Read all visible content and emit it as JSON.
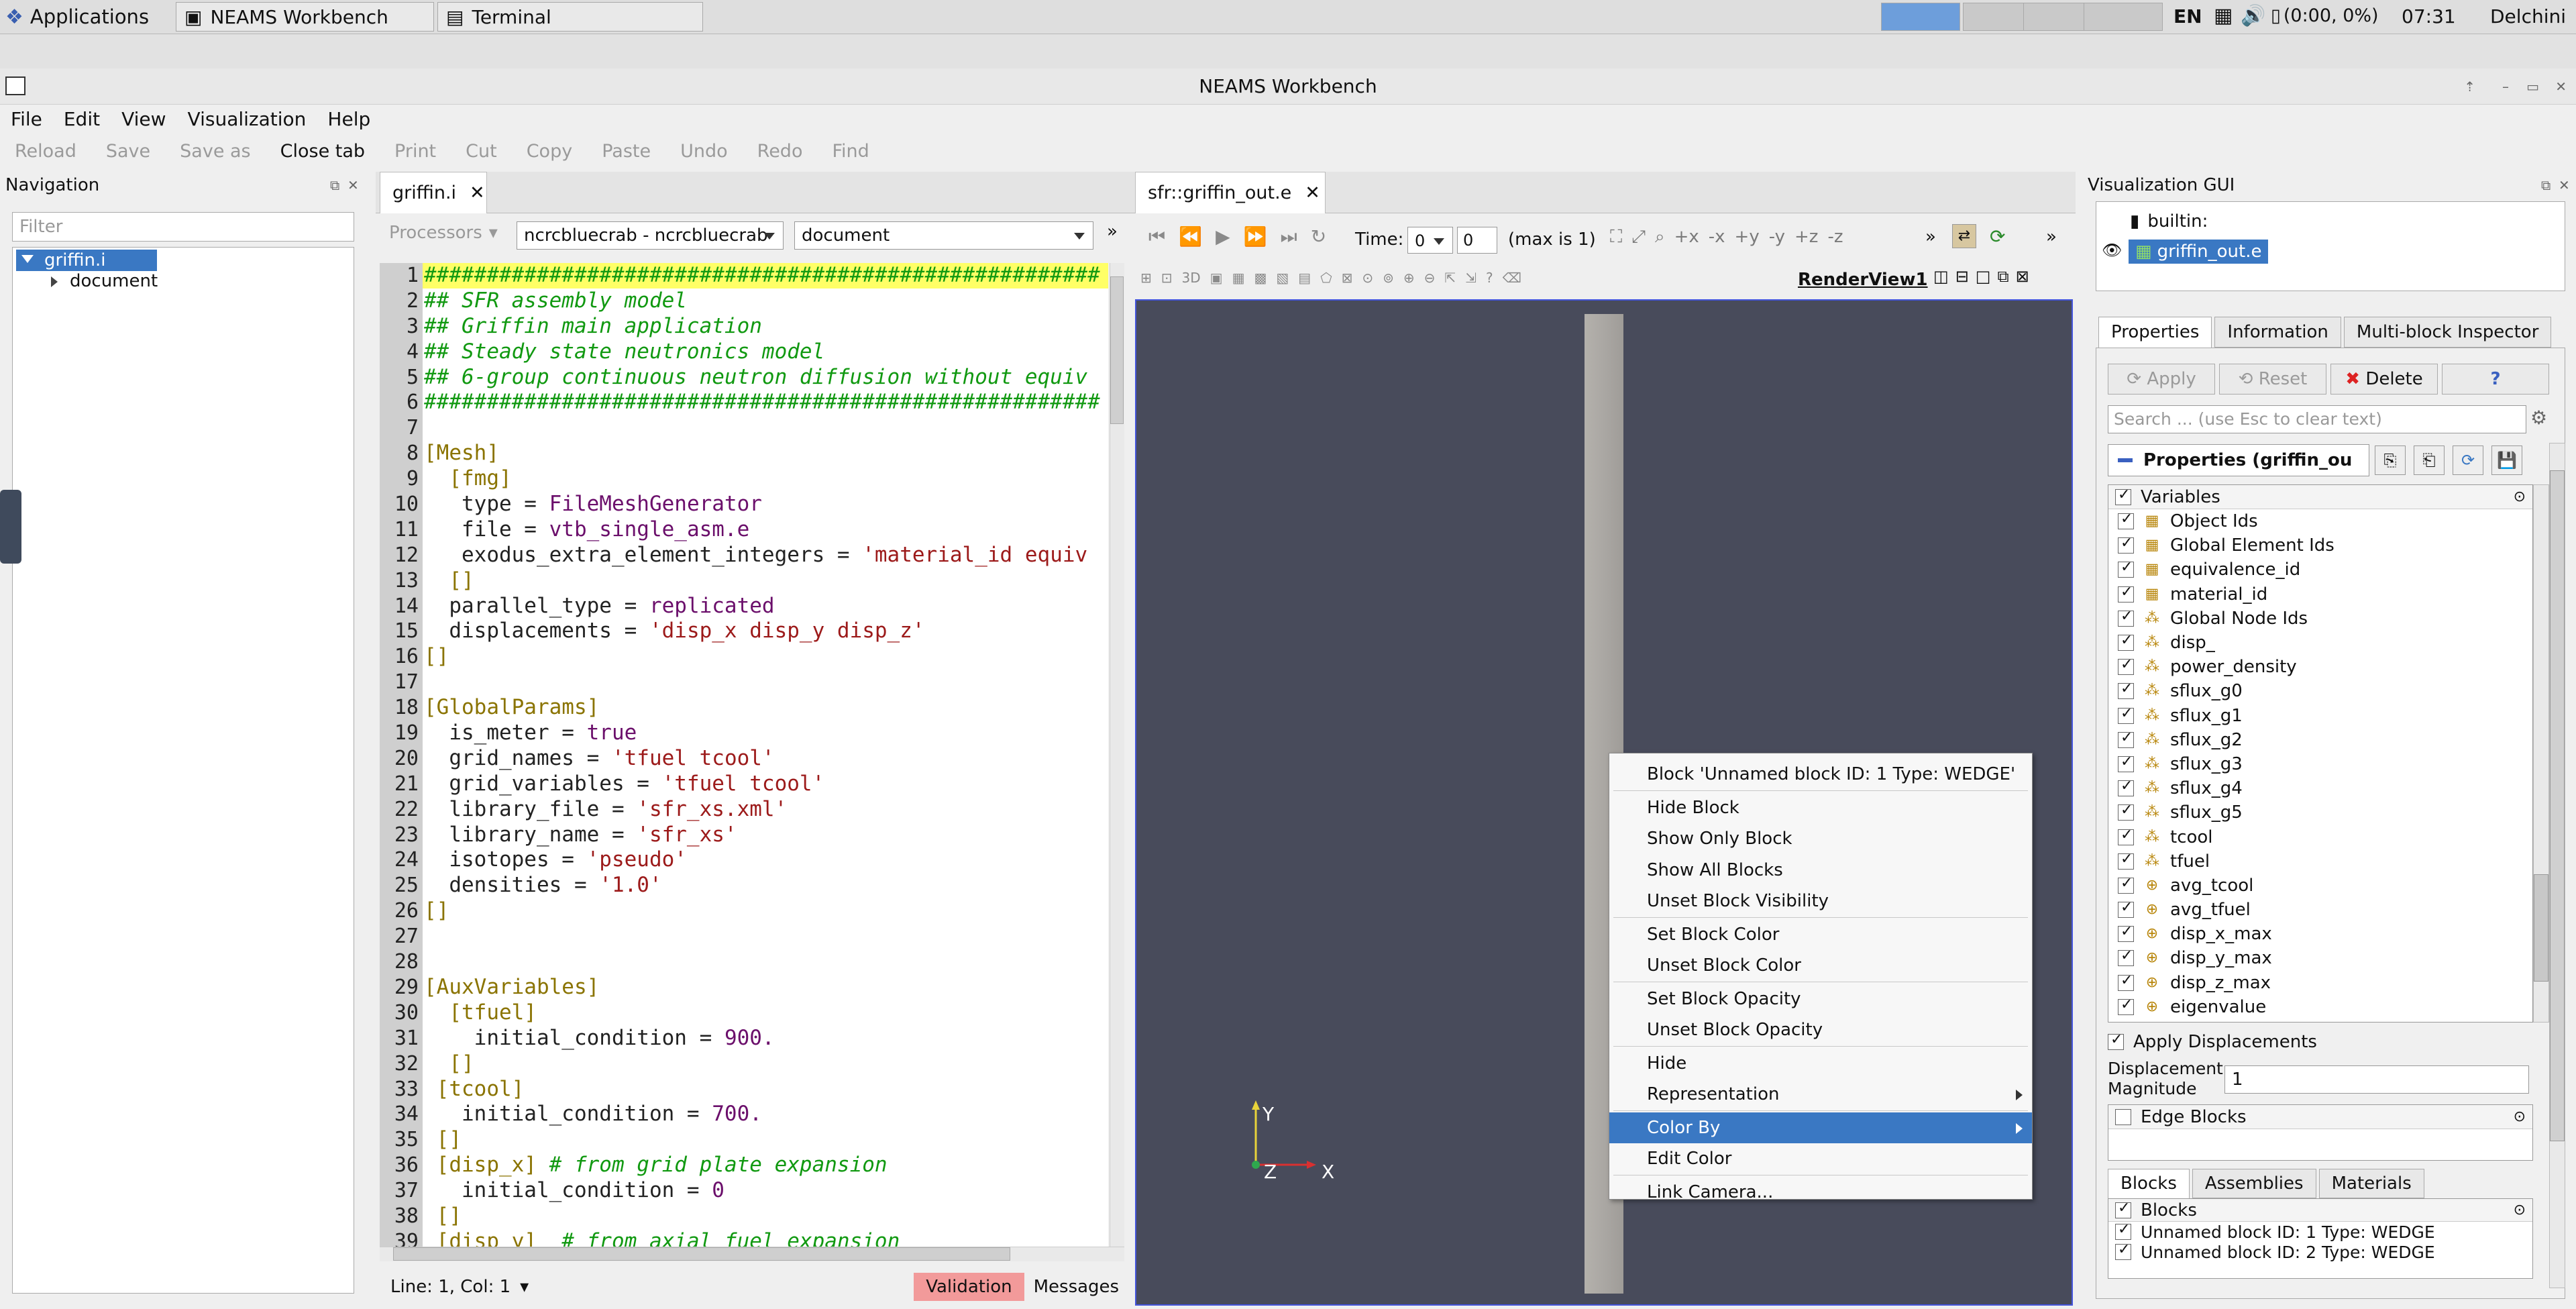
{
  "taskbar": {
    "applications": "Applications",
    "tasks": [
      "NEAMS Workbench",
      "Terminal"
    ],
    "lang": "EN",
    "battery": "(0:00, 0%)",
    "clock": "07:31",
    "user": "Delchini"
  },
  "window": {
    "title": "NEAMS Workbench"
  },
  "menu": [
    "File",
    "Edit",
    "View",
    "Visualization",
    "Help"
  ],
  "toolbar": [
    "Reload",
    "Save",
    "Save as",
    "Close tab",
    "Print",
    "Cut",
    "Copy",
    "Paste",
    "Undo",
    "Redo",
    "Find"
  ],
  "navigation": {
    "title": "Navigation",
    "filter_placeholder": "Filter",
    "root": "griffin.i",
    "child": "document"
  },
  "editor": {
    "tab": "griffin.i",
    "processors_label": "Processors",
    "processor": "ncrcbluecrab - ncrcbluecrab",
    "mode": "document",
    "status": "Line: 1, Col: 1",
    "validation": "Validation",
    "messages": "Messages",
    "lines": [
      {
        "n": "1",
        "t": "cm",
        "s": "######################################################"
      },
      {
        "n": "2",
        "t": "cm",
        "s": "## SFR assembly model"
      },
      {
        "n": "3",
        "t": "cm",
        "s": "## Griffin main application"
      },
      {
        "n": "4",
        "t": "cm",
        "s": "## Steady state neutronics model"
      },
      {
        "n": "5",
        "t": "cm",
        "s": "## 6-group continuous neutron diffusion without equiv"
      },
      {
        "n": "6",
        "t": "cm",
        "s": "######################################################"
      },
      {
        "n": "7",
        "t": "key",
        "s": ""
      },
      {
        "n": "8",
        "t": "sec",
        "s": "[Mesh]"
      },
      {
        "n": "9",
        "t": "sec",
        "s": "  [fmg]"
      },
      {
        "n": "10",
        "t": "kv",
        "k": "   type = ",
        "v": "FileMeshGenerator",
        "vt": "kw"
      },
      {
        "n": "11",
        "t": "kv",
        "k": "   file = ",
        "v": "vtb_single_asm.e",
        "vt": "kw"
      },
      {
        "n": "12",
        "t": "kv",
        "k": "   exodus_extra_element_integers = ",
        "v": "'material_id equiv",
        "vt": "str"
      },
      {
        "n": "13",
        "t": "sec",
        "s": "  []"
      },
      {
        "n": "14",
        "t": "kv",
        "k": "  parallel_type = ",
        "v": "replicated",
        "vt": "kw"
      },
      {
        "n": "15",
        "t": "kv",
        "k": "  displacements = ",
        "v": "'disp_x disp_y disp_z'",
        "vt": "str"
      },
      {
        "n": "16",
        "t": "sec",
        "s": "[]"
      },
      {
        "n": "17",
        "t": "key",
        "s": ""
      },
      {
        "n": "18",
        "t": "sec",
        "s": "[GlobalParams]"
      },
      {
        "n": "19",
        "t": "kv",
        "k": "  is_meter = ",
        "v": "true",
        "vt": "kw"
      },
      {
        "n": "20",
        "t": "kv",
        "k": "  grid_names = ",
        "v": "'tfuel tcool'",
        "vt": "str"
      },
      {
        "n": "21",
        "t": "kv",
        "k": "  grid_variables = ",
        "v": "'tfuel tcool'",
        "vt": "str"
      },
      {
        "n": "22",
        "t": "kv",
        "k": "  library_file = ",
        "v": "'sfr_xs.xml'",
        "vt": "str"
      },
      {
        "n": "23",
        "t": "kv",
        "k": "  library_name = ",
        "v": "'sfr_xs'",
        "vt": "str"
      },
      {
        "n": "24",
        "t": "kv",
        "k": "  isotopes = ",
        "v": "'pseudo'",
        "vt": "str"
      },
      {
        "n": "25",
        "t": "kv",
        "k": "  densities = ",
        "v": "'1.0'",
        "vt": "str"
      },
      {
        "n": "26",
        "t": "sec",
        "s": "[]"
      },
      {
        "n": "27",
        "t": "key",
        "s": ""
      },
      {
        "n": "28",
        "t": "key",
        "s": ""
      },
      {
        "n": "29",
        "t": "sec",
        "s": "[AuxVariables]"
      },
      {
        "n": "30",
        "t": "sec",
        "s": "  [tfuel]"
      },
      {
        "n": "31",
        "t": "kv",
        "k": "    initial_condition = ",
        "v": "900.",
        "vt": "kw"
      },
      {
        "n": "32",
        "t": "sec",
        "s": "  []"
      },
      {
        "n": "33",
        "t": "sec",
        "s": " [tcool]"
      },
      {
        "n": "34",
        "t": "kv",
        "k": "   initial_condition = ",
        "v": "700.",
        "vt": "kw"
      },
      {
        "n": "35",
        "t": "sec",
        "s": " []"
      },
      {
        "n": "36",
        "t": "seccm",
        "k": " [disp_x]",
        "v": " # from grid plate expansion"
      },
      {
        "n": "37",
        "t": "kv",
        "k": "   initial_condition = ",
        "v": "0",
        "vt": "kw"
      },
      {
        "n": "38",
        "t": "sec",
        "s": " []"
      },
      {
        "n": "39",
        "t": "seccm",
        "k": " [disp_y]",
        "v": "  # from axial fuel expansion"
      }
    ]
  },
  "viewer": {
    "tab": "sfr::griffin_out.e",
    "time_label": "Time:",
    "time_value": "0",
    "time_index": "0",
    "time_max": "(max is 1)",
    "render_view": "RenderView1",
    "axis_y": "Y",
    "axis_z": "Z",
    "axis_x": "X"
  },
  "context_menu": {
    "items": [
      {
        "label": "Block 'Unnamed block ID: 1 Type: WEDGE'"
      },
      {
        "sep": true
      },
      {
        "label": "Hide Block"
      },
      {
        "label": "Show Only Block"
      },
      {
        "label": "Show All Blocks"
      },
      {
        "label": "Unset Block Visibility"
      },
      {
        "sep": true
      },
      {
        "label": "Set Block Color"
      },
      {
        "label": "Unset Block Color"
      },
      {
        "sep": true
      },
      {
        "label": "Set Block Opacity"
      },
      {
        "label": "Unset Block Opacity"
      },
      {
        "sep": true
      },
      {
        "label": "Hide"
      },
      {
        "label": "Representation",
        "sub": true
      },
      {
        "sep": true
      },
      {
        "label": "Color By",
        "sub": true,
        "selected": true
      },
      {
        "label": "Edit Color"
      },
      {
        "sep": true
      },
      {
        "label": "Link Camera..."
      }
    ]
  },
  "vis_gui": {
    "title": "Visualization GUI",
    "pipeline": [
      "builtin:",
      "griffin_out.e"
    ],
    "tabs": [
      "Properties",
      "Information",
      "Multi-block Inspector"
    ],
    "apply": "Apply",
    "reset": "Reset",
    "delete": "Delete",
    "help": "?",
    "search_placeholder": "Search ... (use Esc to clear text)",
    "properties_header": "Properties (griffin_ou",
    "variables_header": "Variables",
    "variables": [
      {
        "name": "Object Ids",
        "icon": "cell"
      },
      {
        "name": "Global Element Ids",
        "icon": "cell"
      },
      {
        "name": "equivalence_id",
        "icon": "cell"
      },
      {
        "name": "material_id",
        "icon": "cell"
      },
      {
        "name": "Global Node Ids",
        "icon": "point"
      },
      {
        "name": "disp_",
        "icon": "point"
      },
      {
        "name": "power_density",
        "icon": "point"
      },
      {
        "name": "sflux_g0",
        "icon": "point"
      },
      {
        "name": "sflux_g1",
        "icon": "point"
      },
      {
        "name": "sflux_g2",
        "icon": "point"
      },
      {
        "name": "sflux_g3",
        "icon": "point"
      },
      {
        "name": "sflux_g4",
        "icon": "point"
      },
      {
        "name": "sflux_g5",
        "icon": "point"
      },
      {
        "name": "tcool",
        "icon": "point"
      },
      {
        "name": "tfuel",
        "icon": "point"
      },
      {
        "name": "avg_tcool",
        "icon": "global"
      },
      {
        "name": "avg_tfuel",
        "icon": "global"
      },
      {
        "name": "disp_x_max",
        "icon": "global"
      },
      {
        "name": "disp_y_max",
        "icon": "global"
      },
      {
        "name": "disp_z_max",
        "icon": "global"
      },
      {
        "name": "eigenvalue",
        "icon": "global"
      }
    ],
    "apply_displacements": "Apply Displacements",
    "displacement_magnitude_label": "Displacement Magnitude",
    "displacement_magnitude": "1",
    "edge_blocks": "Edge Blocks",
    "bottom_tabs": [
      "Blocks",
      "Assemblies",
      "Materials"
    ],
    "blocks_header": "Blocks",
    "blocks": [
      "Unnamed block ID: 1 Type: WEDGE",
      "Unnamed block ID: 2 Type: WEDGE"
    ]
  }
}
